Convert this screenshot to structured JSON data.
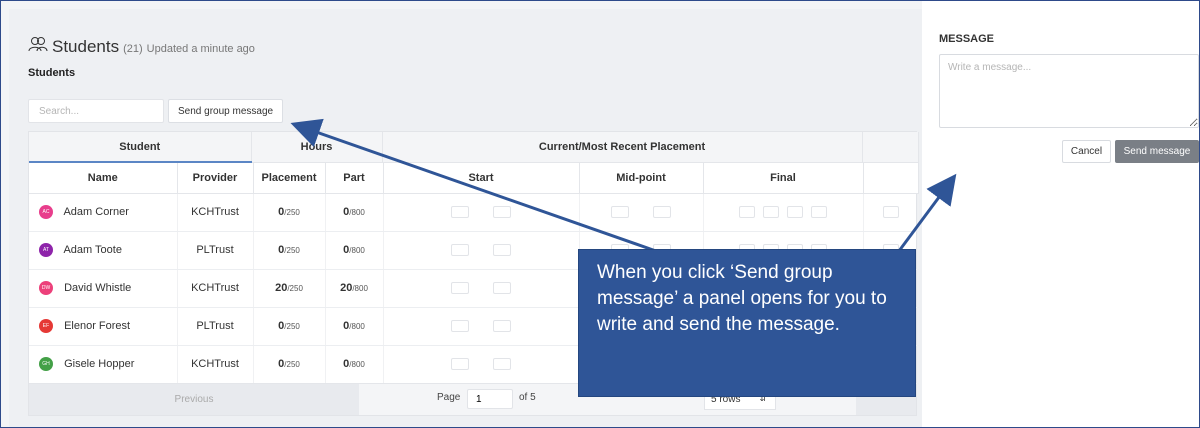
{
  "header": {
    "title": "Students",
    "count": "(21)",
    "updated": "Updated a minute ago",
    "subtitle": "Students"
  },
  "toolbar": {
    "search_placeholder": "Search...",
    "group_message_label": "Send group message"
  },
  "table": {
    "group_headers": {
      "student": "Student",
      "hours": "Hours",
      "placement": "Current/Most Recent Placement"
    },
    "columns": {
      "name": "Name",
      "provider": "Provider",
      "placement": "Placement",
      "part": "Part",
      "start": "Start",
      "midpoint": "Mid-point",
      "final": "Final"
    },
    "rows": [
      {
        "initials": "AC",
        "name": "Adam Corner",
        "provider": "KCHTrust",
        "placement": "0",
        "placement_total": "/250",
        "part": "0",
        "part_total": "/800",
        "avatar_color": "#e83e8c"
      },
      {
        "initials": "AT",
        "name": "Adam Toote",
        "provider": "PLTrust",
        "placement": "0",
        "placement_total": "/250",
        "part": "0",
        "part_total": "/800",
        "avatar_color": "#8e24aa"
      },
      {
        "initials": "DW",
        "name": "David Whistle",
        "provider": "KCHTrust",
        "placement": "20",
        "placement_total": "/250",
        "part": "20",
        "part_total": "/800",
        "avatar_color": "#ec407a"
      },
      {
        "initials": "EF",
        "name": "Elenor Forest",
        "provider": "PLTrust",
        "placement": "0",
        "placement_total": "/250",
        "part": "0",
        "part_total": "/800",
        "avatar_color": "#e53935"
      },
      {
        "initials": "GH",
        "name": "Gisele Hopper",
        "provider": "KCHTrust",
        "placement": "0",
        "placement_total": "/250",
        "part": "0",
        "part_total": "/800",
        "avatar_color": "#43a047"
      }
    ]
  },
  "pagination": {
    "previous": "Previous",
    "page_label": "Page",
    "page_value": "1",
    "of_label": "of 5",
    "rows_option": "5 rows"
  },
  "panel": {
    "label": "MESSAGE",
    "placeholder": "Write a message...",
    "cancel": "Cancel",
    "send": "Send message"
  },
  "callout": {
    "text": "When you click ‘Send group message’ a panel opens for you to write and send the message."
  }
}
